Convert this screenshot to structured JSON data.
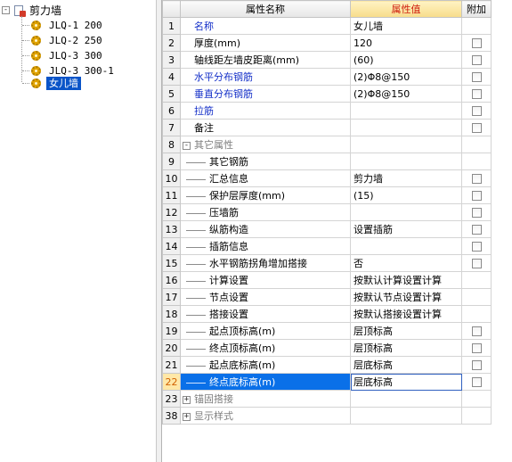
{
  "tree": {
    "root_label": "剪力墙",
    "items": [
      {
        "label": "JLQ-1 200",
        "selected": false
      },
      {
        "label": "JLQ-2 250",
        "selected": false
      },
      {
        "label": "JLQ-3  300",
        "selected": false
      },
      {
        "label": "JLQ-3  300-1",
        "selected": false
      },
      {
        "label": "女儿墙",
        "selected": true
      }
    ]
  },
  "grid": {
    "headers": {
      "name": "属性名称",
      "value": "属性值",
      "extra": "附加"
    },
    "rows": [
      {
        "num": "1",
        "name": "名称",
        "value": "女儿墙",
        "check": false
      },
      {
        "num": "2",
        "name": "厚度(mm)",
        "value": "120",
        "check": true
      },
      {
        "num": "3",
        "name": "轴线距左墙皮距离(mm)",
        "value": "(60)",
        "check": true
      },
      {
        "num": "4",
        "name": "水平分布钢筋",
        "value": "(2)Φ8@150",
        "check": true
      },
      {
        "num": "5",
        "name": "垂直分布钢筋",
        "value": "(2)Φ8@150",
        "check": true
      },
      {
        "num": "6",
        "name": "拉筋",
        "value": "",
        "check": true
      },
      {
        "num": "7",
        "name": "备注",
        "value": "",
        "check": true
      },
      {
        "num": "8",
        "name": "其它属性",
        "value": "",
        "check": null
      },
      {
        "num": "9",
        "name": "其它钢筋",
        "value": "",
        "check": null
      },
      {
        "num": "10",
        "name": "汇总信息",
        "value": "剪力墙",
        "check": true
      },
      {
        "num": "11",
        "name": "保护层厚度(mm)",
        "value": "(15)",
        "check": true
      },
      {
        "num": "12",
        "name": "压墙筋",
        "value": "",
        "check": true
      },
      {
        "num": "13",
        "name": "纵筋构造",
        "value": "设置插筋",
        "check": true
      },
      {
        "num": "14",
        "name": "插筋信息",
        "value": "",
        "check": true
      },
      {
        "num": "15",
        "name": "水平钢筋拐角增加搭接",
        "value": "否",
        "check": true
      },
      {
        "num": "16",
        "name": "计算设置",
        "value": "按默认计算设置计算",
        "check": null
      },
      {
        "num": "17",
        "name": "节点设置",
        "value": "按默认节点设置计算",
        "check": null
      },
      {
        "num": "18",
        "name": "搭接设置",
        "value": "按默认搭接设置计算",
        "check": null
      },
      {
        "num": "19",
        "name": "起点顶标高(m)",
        "value": "层顶标高",
        "check": true
      },
      {
        "num": "20",
        "name": "终点顶标高(m)",
        "value": "层顶标高",
        "check": true
      },
      {
        "num": "21",
        "name": "起点底标高(m)",
        "value": "层底标高",
        "check": true
      },
      {
        "num": "22",
        "name": "终点底标高(m)",
        "value": "层底标高",
        "check": true
      },
      {
        "num": "23",
        "name": "锚固搭接",
        "value": "",
        "check": null
      },
      {
        "num": "38",
        "name": "显示样式",
        "value": "",
        "check": null
      }
    ],
    "expander_collapsed": "+",
    "expander_expanded": "-"
  },
  "colors": {
    "selection": "#0a54c8",
    "name_blue": "#1530c8",
    "header_value": "#d02010"
  }
}
